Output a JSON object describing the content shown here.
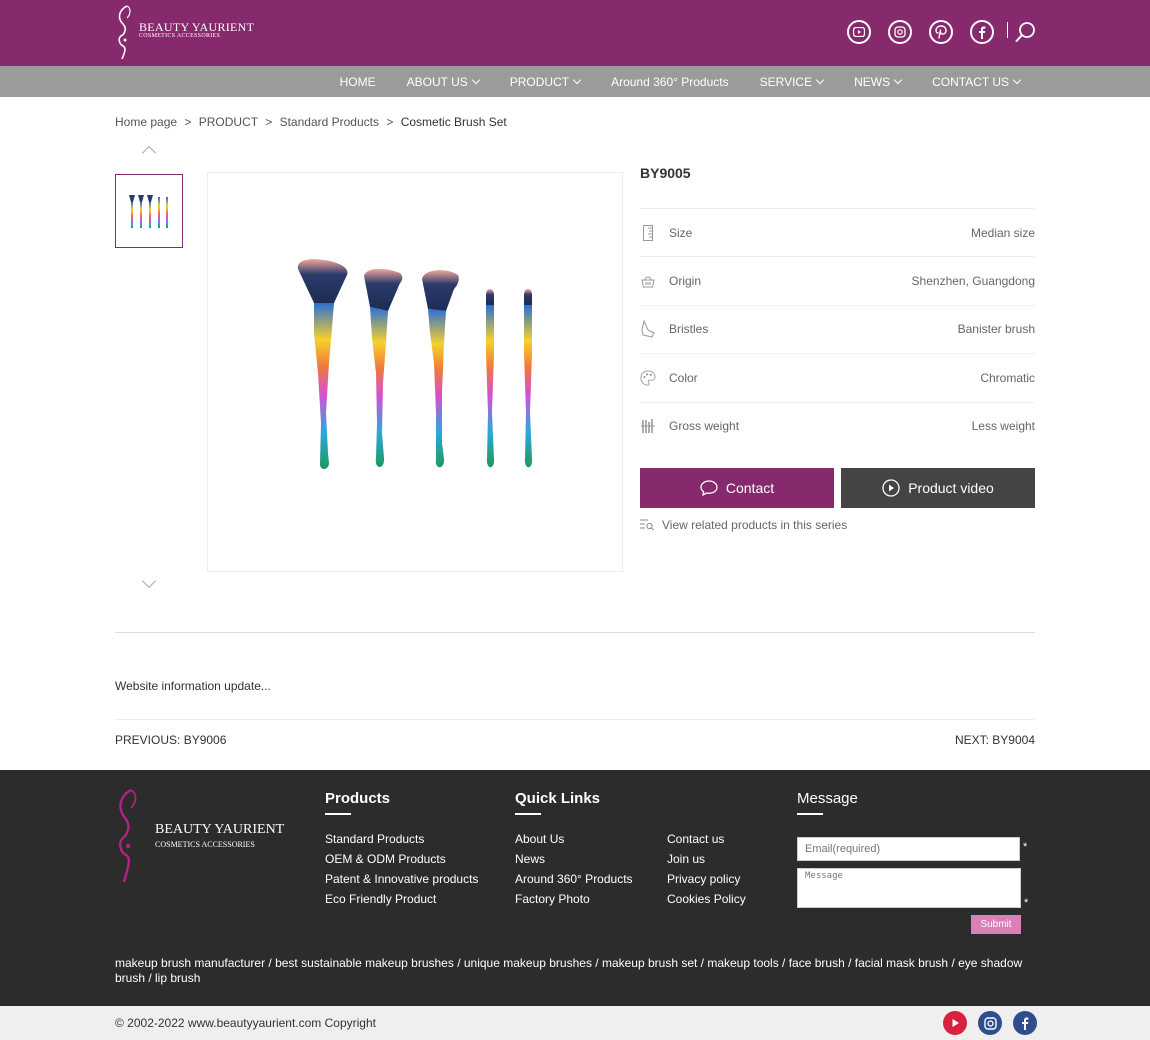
{
  "header": {
    "logo_name": "BEAUTY YAURIENT",
    "logo_tagline": "COSMETICS ACCESSORIES"
  },
  "nav": {
    "items": [
      {
        "label": "HOME",
        "dropdown": false
      },
      {
        "label": "ABOUT US",
        "dropdown": true
      },
      {
        "label": "PRODUCT",
        "dropdown": true
      },
      {
        "label": "Around 360° Products",
        "dropdown": false
      },
      {
        "label": "SERVICE",
        "dropdown": true
      },
      {
        "label": "NEWS",
        "dropdown": true
      },
      {
        "label": "CONTACT US",
        "dropdown": true
      }
    ]
  },
  "breadcrumb": {
    "items": [
      "Home page",
      "PRODUCT",
      "Standard Products",
      "Cosmetic Brush Set"
    ],
    "separator": ">"
  },
  "product": {
    "code": "BY9005",
    "specs": [
      {
        "icon": "ruler-icon",
        "label": "Size",
        "value": "Median size"
      },
      {
        "icon": "basket-icon",
        "label": "Origin",
        "value": "Shenzhen, Guangdong"
      },
      {
        "icon": "brush-icon",
        "label": "Bristles",
        "value": "Banister brush"
      },
      {
        "icon": "palette-icon",
        "label": "Color",
        "value": "Chromatic"
      },
      {
        "icon": "weight-icon",
        "label": "Gross weight",
        "value": "Less weight"
      }
    ],
    "contact_label": "Contact",
    "video_label": "Product video",
    "related_label": "View related products in this series"
  },
  "content": {
    "update_text": "Website information update...",
    "prev_label": "PREVIOUS:",
    "prev_value": "BY9006",
    "next_label": "NEXT:",
    "next_value": "BY9004"
  },
  "footer": {
    "products_title": "Products",
    "products": [
      "Standard Products",
      "OEM & ODM Products",
      "Patent & Innovative products",
      "Eco Friendly Product"
    ],
    "quicklinks_title": "Quick Links",
    "quicklinks_col1": [
      "About Us",
      "News",
      "Around 360° Products",
      "Factory Photo"
    ],
    "quicklinks_col2": [
      "Contact us",
      "Join us",
      "Privacy policy",
      "Cookies Policy"
    ],
    "message_title": "Message",
    "email_placeholder": "Email(required)",
    "message_placeholder": "Message",
    "required_mark": "*",
    "submit_label": "Submit",
    "keywords": "makeup brush manufacturer / best sustainable makeup brushes / unique makeup brushes / makeup brush set / makeup tools / face brush / facial mask brush / eye shadow brush / lip brush",
    "copyright": "© 2002-2022 www.beautyyaurient.com Copyright"
  },
  "colors": {
    "brand": "#872a6d",
    "nav_bg": "#9b9b9b",
    "footer_bg": "#2c2c2c",
    "submit": "#db7fb7",
    "video_btn": "#444444"
  }
}
